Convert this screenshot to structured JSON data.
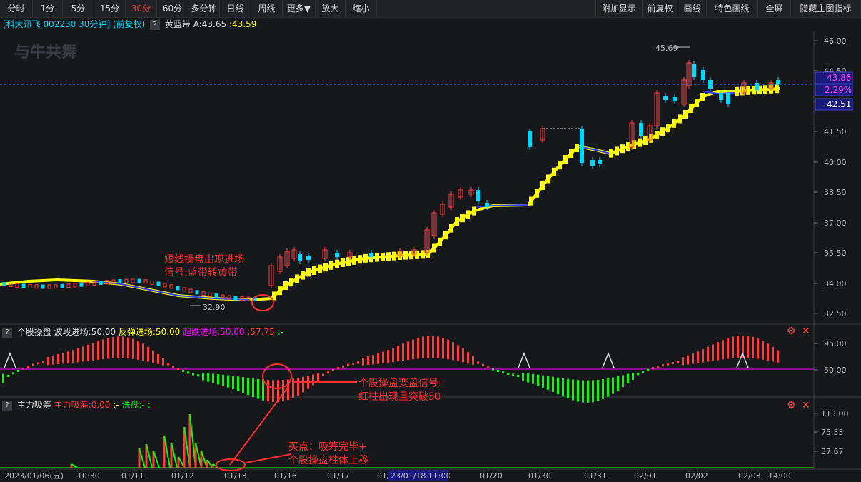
{
  "toolbar": {
    "left_buttons": [
      "分时",
      "1分",
      "5分",
      "15分",
      "30分",
      "60分",
      "多分钟",
      "日线",
      "周线",
      "更多▼",
      "放大",
      "缩小"
    ],
    "active_index": 4,
    "right_buttons": [
      "附加显示",
      "前复权",
      "画线",
      "特色画线",
      "全屏",
      "隐藏主图指标"
    ]
  },
  "main": {
    "stock_label": "[科大讯飞 002230 30分钟] (前复权)",
    "indicator_name": "黄蓝带",
    "indicator_a": "A:43.65",
    "indicator_b": ":43.59",
    "watermark": "与牛共舞",
    "price_ticks": [
      "46.00",
      "44.50",
      "43.00",
      "41.50",
      "40.00",
      "38.50",
      "37.00",
      "35.50",
      "34.00",
      "32.50"
    ],
    "high_label": "45.69",
    "low_label": "32.90",
    "current_price": "43.86",
    "change_pct": "2.29%",
    "cursor_price": "42.51",
    "annotation_1_line1": "短线操盘出现进场",
    "annotation_1_line2": "信号:蓝带转黄带"
  },
  "panel2": {
    "name": "个股操盘",
    "v1": "波段进场:50.00",
    "v2": "反弹进场:50.00",
    "v3": "超跌进场:50.00",
    "v4": ":57.75",
    "v5": ":-",
    "ticks": [
      "95.00",
      "50.00"
    ],
    "annotation_line1": "个股操盘变盘信号:",
    "annotation_line2": "红柱出现且突破50"
  },
  "panel3": {
    "name": "主力吸筹",
    "v1": "主力吸筹:0.00",
    "v2": ":-",
    "v3": "洗盘:-",
    "v4": ":",
    "ticks": [
      "113.00",
      "75.33",
      "37.67"
    ],
    "annotation_line1": "买点：吸筹完毕+",
    "annotation_line2": "个股操盘柱体上移"
  },
  "time_axis": {
    "labels": [
      "2023/01/06(五)",
      "10:30",
      "01/11",
      "01/12",
      "01/13",
      "01/16",
      "01/17",
      "01/18",
      "01/20",
      "01/30",
      "01/31",
      "02/01",
      "02/02",
      "02/03",
      "14:00"
    ],
    "cursor_label": "23/01/18 11:00"
  },
  "colors": {
    "up": "#ff3b3b",
    "down": "#00d8ff",
    "yellow": "#ffff00",
    "blue": "#2e3cff",
    "magenta": "#ff00ff",
    "green": "#00ff00",
    "annot": "#ff3030"
  }
}
